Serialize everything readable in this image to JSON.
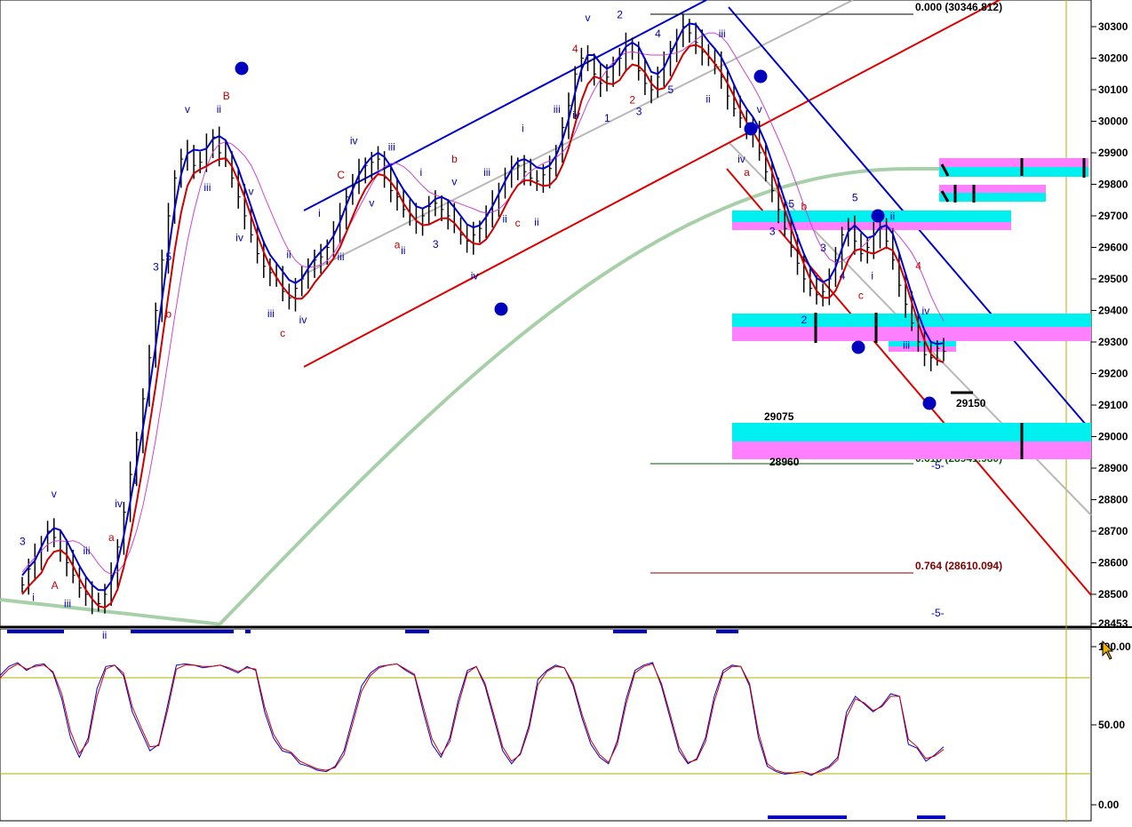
{
  "chart_data": [
    {
      "type": "ohlc",
      "panel": "price",
      "y_axis_ticks": [
        "30300",
        "30200",
        "30100",
        "30000",
        "29900",
        "29800",
        "29700",
        "29600",
        "29500",
        "29400",
        "29300",
        "29200",
        "29100",
        "29000",
        "28900",
        "28800",
        "28700",
        "28600",
        "28500",
        "28453"
      ],
      "ylim": [
        28453,
        30380
      ],
      "fib_levels": [
        {
          "label": "0.000 (30346.812)",
          "value": 30346.812,
          "color": "#000000"
        },
        {
          "label": "0.618 (28941.980)",
          "value": 28941.98,
          "color": "#006000"
        },
        {
          "label": "0.764 (28610.094)",
          "value": 28610.094,
          "color": "#800000"
        }
      ],
      "price_levels": [
        {
          "label": "29075",
          "value": 29075
        },
        {
          "label": "28960",
          "value": 28960
        },
        {
          "label": "29150",
          "value": 29150
        }
      ],
      "fib_markers": [
        "-5-",
        "-5-"
      ],
      "wave_labels_blue": [
        "3",
        "i",
        "v",
        "iii",
        "iii",
        "ii",
        "iv",
        "i",
        "3",
        "5",
        "v",
        "iii",
        "ii",
        "iv",
        "v",
        "iii",
        "ii",
        "iv",
        "i",
        "iii",
        "iv",
        "v",
        "iii",
        "ii",
        "i",
        "3",
        "v",
        "iv",
        "iii",
        "ii",
        "i",
        "ii",
        "iii",
        "iv",
        "v",
        "1",
        "2",
        "3",
        "4",
        "5",
        "1",
        "ii",
        "iii",
        "iv",
        "v",
        "3",
        "5",
        "2",
        "3",
        "4",
        "5",
        "i",
        "ii",
        "iii",
        "iv"
      ],
      "wave_circle_blue": [
        "3",
        "4",
        "1",
        "2",
        "3",
        "4",
        "5"
      ],
      "wave_labels_red": [
        "A",
        "a",
        "b",
        "B",
        "c",
        "C",
        "a",
        "b",
        "c",
        "4",
        "2",
        "1",
        "a",
        "b",
        "c",
        "4"
      ],
      "close_series": [
        28530,
        28580,
        28620,
        28660,
        28700,
        28680,
        28640,
        28600,
        28560,
        28520,
        28500,
        28480,
        28470,
        28500,
        28560,
        28650,
        28760,
        28880,
        28990,
        29120,
        29250,
        29400,
        29560,
        29700,
        29820,
        29880,
        29900,
        29860,
        29870,
        29920,
        29950,
        29900,
        29880,
        29820,
        29760,
        29700,
        29640,
        29580,
        29540,
        29520,
        29500,
        29460,
        29440,
        29470,
        29500,
        29540,
        29560,
        29570,
        29600,
        29650,
        29700,
        29760,
        29800,
        29840,
        29860,
        29870,
        29880,
        29820,
        29780,
        29760,
        29720,
        29700,
        29680,
        29700,
        29730,
        29740,
        29720,
        29700,
        29670,
        29640,
        29620,
        29640,
        29660,
        29700,
        29740,
        29780,
        29820,
        29850,
        29860,
        29840,
        29820,
        29810,
        29830,
        29850,
        29900,
        29980,
        30050,
        30150,
        30200,
        30190,
        30150,
        30120,
        30140,
        30180,
        30200,
        30240,
        30220,
        30160,
        30120,
        30100,
        30140,
        30180,
        30230,
        30260,
        30300,
        30280,
        30250,
        30220,
        30200,
        30180,
        30140,
        30080,
        30040,
        30010,
        29980,
        29960,
        29900,
        29840,
        29780,
        29720,
        29660,
        29600,
        29550,
        29500,
        29470,
        29450,
        29460,
        29500,
        29560,
        29640,
        29660,
        29620,
        29580,
        29600,
        29640,
        29660,
        29620,
        29560,
        29480,
        29420,
        29360,
        29300,
        29260,
        29250,
        29280,
        29270
      ]
    },
    {
      "type": "line",
      "panel": "stochastic",
      "y_axis_ticks": [
        "100.00",
        "50.00",
        "0.00"
      ],
      "ylim": [
        0,
        100
      ],
      "reference_lines": [
        80,
        20
      ],
      "series": [
        {
          "color": "#0000cc",
          "values": [
            88,
            95,
            98,
            92,
            96,
            97,
            90,
            70,
            40,
            25,
            40,
            78,
            95,
            96,
            88,
            60,
            45,
            30,
            35,
            65,
            96,
            97,
            96,
            94,
            95,
            96,
            93,
            90,
            95,
            92,
            60,
            40,
            30,
            28,
            20,
            18,
            15,
            14,
            18,
            30,
            55,
            80,
            90,
            95,
            96,
            97,
            92,
            88,
            60,
            35,
            25,
            40,
            70,
            92,
            95,
            80,
            55,
            30,
            20,
            28,
            50,
            85,
            92,
            96,
            94,
            80,
            55,
            35,
            25,
            20,
            38,
            70,
            92,
            96,
            98,
            80,
            55,
            30,
            20,
            24,
            40,
            72,
            92,
            96,
            95,
            80,
            40,
            18,
            14,
            12,
            13,
            14,
            11,
            15,
            18,
            25,
            60,
            72,
            66,
            60,
            65,
            74,
            72,
            35,
            32,
            22,
            27,
            33
          ]
        },
        {
          "color": "#cc0000",
          "values": [
            86,
            93,
            97,
            93,
            95,
            96,
            91,
            74,
            45,
            28,
            37,
            72,
            93,
            96,
            90,
            64,
            48,
            33,
            34,
            61,
            93,
            96,
            96,
            95,
            95,
            96,
            94,
            91,
            94,
            93,
            64,
            43,
            32,
            29,
            22,
            19,
            16,
            15,
            17,
            27,
            51,
            76,
            88,
            94,
            96,
            97,
            93,
            89,
            64,
            39,
            27,
            37,
            66,
            90,
            95,
            82,
            58,
            33,
            22,
            27,
            47,
            81,
            91,
            95,
            94,
            82,
            58,
            38,
            27,
            21,
            35,
            66,
            90,
            95,
            97,
            82,
            58,
            33,
            21,
            23,
            37,
            68,
            90,
            95,
            95,
            82,
            44,
            20,
            15,
            13,
            13,
            14,
            12,
            14,
            17,
            23,
            56,
            70,
            67,
            61,
            64,
            72,
            72,
            39,
            33,
            24,
            26,
            31
          ]
        }
      ]
    }
  ],
  "colors": {
    "background": "#ffffff",
    "price_bar": "#000000",
    "ma_blue": "#0000cc",
    "ma_red": "#cc0000",
    "ma_magenta": "#cc44cc",
    "ma_green": "#a8d0a8",
    "channel_blue": "#0000cc",
    "channel_red": "#dd0000",
    "grid_line": "#b0b000",
    "zone_cyan": "#00f0f0",
    "zone_magenta": "#ff80ff"
  }
}
